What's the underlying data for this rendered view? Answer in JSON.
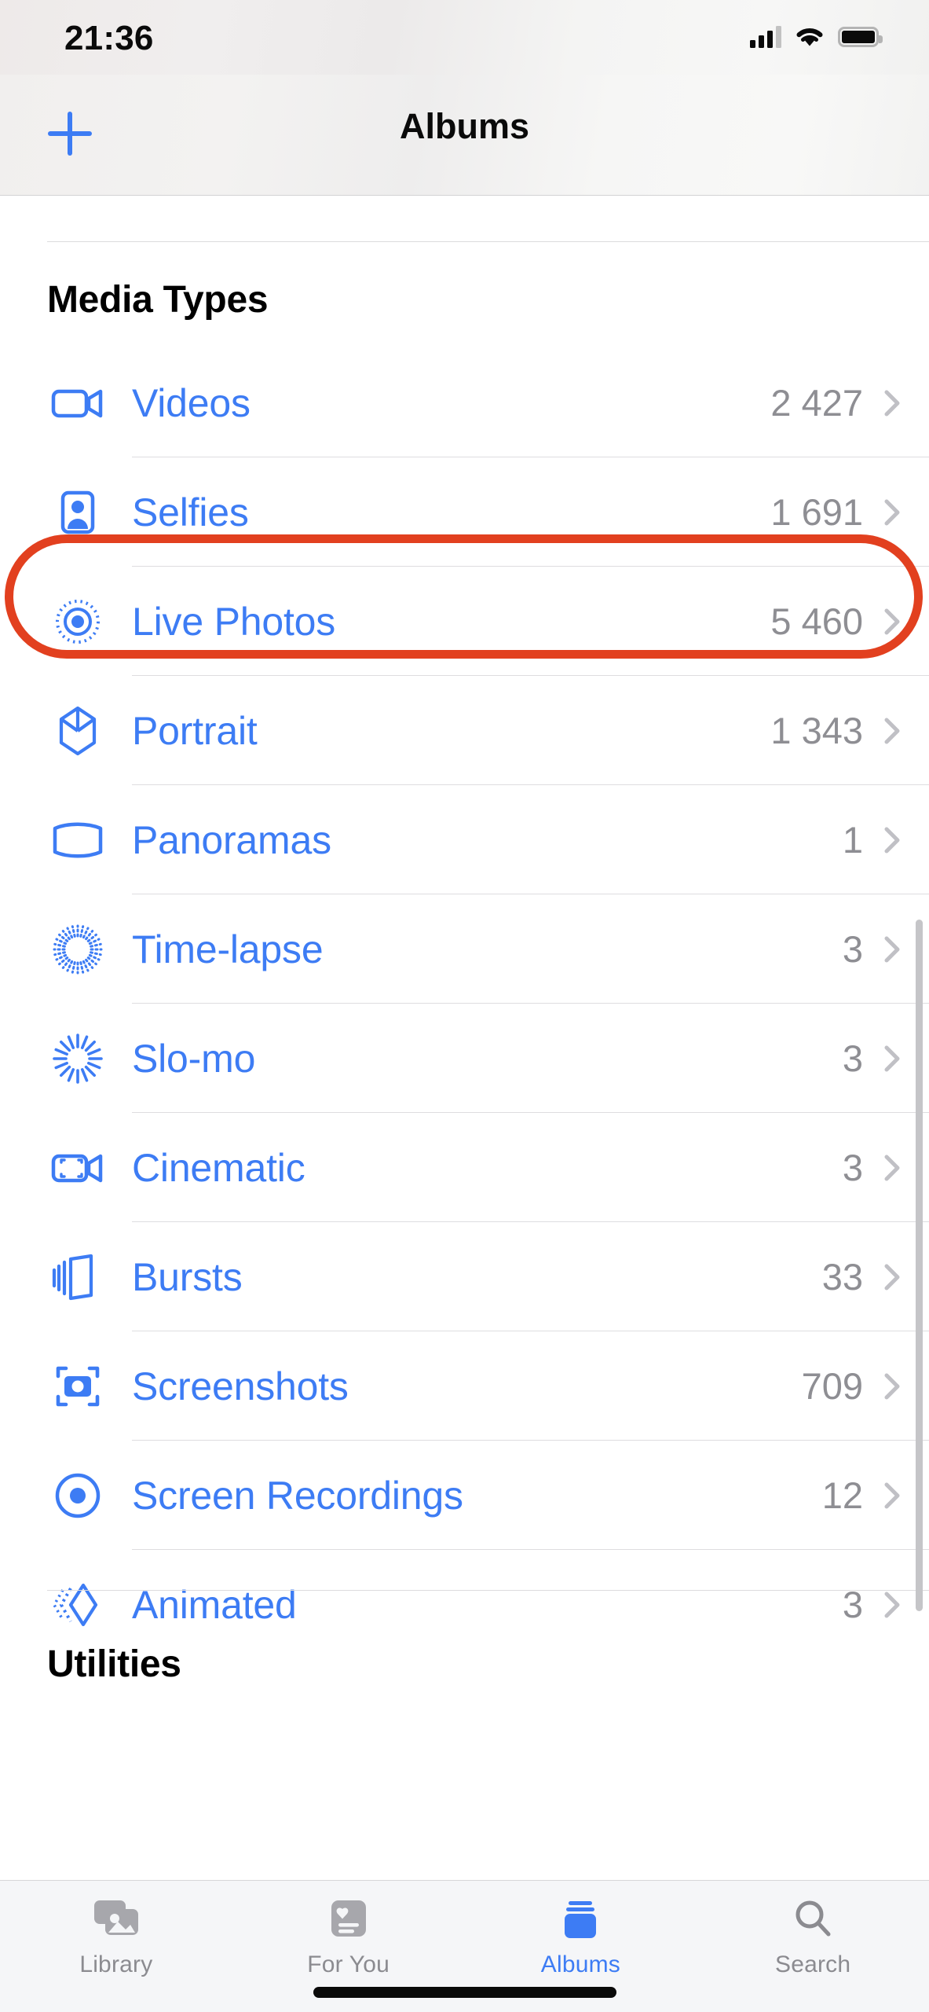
{
  "status_bar": {
    "time": "21:36",
    "cellular_icon": "cellular-signal-icon",
    "wifi_icon": "wifi-icon",
    "battery_icon": "battery-icon"
  },
  "nav_bar": {
    "add_icon": "plus-icon",
    "title": "Albums"
  },
  "sections": [
    {
      "header": "Media Types",
      "rows": [
        {
          "icon": "video-camera-icon",
          "label": "Videos",
          "count": "2 427",
          "highlighted": true
        },
        {
          "icon": "person-portrait-icon",
          "label": "Selfies",
          "count": "1 691"
        },
        {
          "icon": "live-photo-icon",
          "label": "Live Photos",
          "count": "5 460"
        },
        {
          "icon": "cube-icon",
          "label": "Portrait",
          "count": "1 343"
        },
        {
          "icon": "panorama-icon",
          "label": "Panoramas",
          "count": "1"
        },
        {
          "icon": "timelapse-icon",
          "label": "Time-lapse",
          "count": "3"
        },
        {
          "icon": "slomo-icon",
          "label": "Slo-mo",
          "count": "3"
        },
        {
          "icon": "cinematic-video-icon",
          "label": "Cinematic",
          "count": "3"
        },
        {
          "icon": "bursts-icon",
          "label": "Bursts",
          "count": "33"
        },
        {
          "icon": "screenshot-camera-icon",
          "label": "Screenshots",
          "count": "709"
        },
        {
          "icon": "screen-record-icon",
          "label": "Screen Recordings",
          "count": "12"
        },
        {
          "icon": "animated-gif-icon",
          "label": "Animated",
          "count": "3"
        }
      ]
    },
    {
      "header": "Utilities",
      "rows": []
    }
  ],
  "tab_bar": {
    "tabs": [
      {
        "icon": "photo-stack-icon",
        "label": "Library",
        "active": false
      },
      {
        "icon": "heart-card-icon",
        "label": "For You",
        "active": false
      },
      {
        "icon": "album-stack-icon",
        "label": "Albums",
        "active": true
      },
      {
        "icon": "magnifier-icon",
        "label": "Search",
        "active": false
      }
    ]
  },
  "colors": {
    "accent_blue": "#3d7cf4",
    "highlight_red": "#e2401f",
    "count_gray": "#8e8e93",
    "tab_inactive": "#8b8b90"
  },
  "annotation": {
    "type": "highlight-ring",
    "target": "Videos"
  }
}
